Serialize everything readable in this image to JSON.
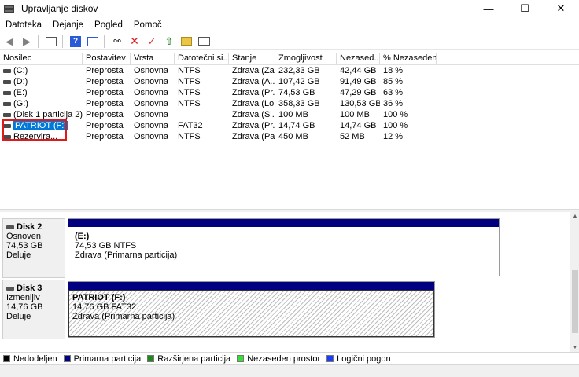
{
  "window": {
    "title": "Upravljanje diskov",
    "minimize": "—",
    "maximize": "☐",
    "close": "✕"
  },
  "menu": [
    "Datoteka",
    "Dejanje",
    "Pogled",
    "Pomoč"
  ],
  "toolbar_icons": [
    "back-arrow-icon",
    "forward-arrow-icon",
    "console-tree-icon",
    "help-icon",
    "properties-icon",
    "connect-icon",
    "delete-icon",
    "check-icon",
    "import-icon",
    "folder-icon",
    "rescan-icon"
  ],
  "columns": [
    "Nosilec",
    "Postavitev",
    "Vrsta",
    "Datotečni si...",
    "Stanje",
    "Zmogljivost",
    "Nezased...",
    "% Nezaseden..."
  ],
  "volumes": [
    {
      "name": "(C:)",
      "layout": "Preprosta",
      "type": "Osnovna",
      "fs": "NTFS",
      "status": "Zdrava (Za...",
      "capacity": "232,33 GB",
      "free": "42,44 GB",
      "pct": "18 %"
    },
    {
      "name": "(D:)",
      "layout": "Preprosta",
      "type": "Osnovna",
      "fs": "NTFS",
      "status": "Zdrava (A...",
      "capacity": "107,42 GB",
      "free": "91,49 GB",
      "pct": "85 %"
    },
    {
      "name": "(E:)",
      "layout": "Preprosta",
      "type": "Osnovna",
      "fs": "NTFS",
      "status": "Zdrava (Pr...",
      "capacity": "74,53 GB",
      "free": "47,29 GB",
      "pct": "63 %"
    },
    {
      "name": "(G:)",
      "layout": "Preprosta",
      "type": "Osnovna",
      "fs": "NTFS",
      "status": "Zdrava (Lo...",
      "capacity": "358,33 GB",
      "free": "130,53 GB",
      "pct": "36 %"
    },
    {
      "name": "(Disk 1 particija 2)",
      "layout": "Preprosta",
      "type": "Osnovna",
      "fs": "",
      "status": "Zdrava (Si...",
      "capacity": "100 MB",
      "free": "100 MB",
      "pct": "100 %"
    },
    {
      "name": "PATRIOT (F:)",
      "layout": "Preprosta",
      "type": "Osnovna",
      "fs": "FAT32",
      "status": "Zdrava (Pr...",
      "capacity": "14,74 GB",
      "free": "14,74 GB",
      "pct": "100 %"
    },
    {
      "name": "Rezervira...",
      "layout": "Preprosta",
      "type": "Osnovna",
      "fs": "NTFS",
      "status": "Zdrava (Pa...",
      "capacity": "450 MB",
      "free": "52 MB",
      "pct": "12 %"
    }
  ],
  "disks": [
    {
      "name": "Disk 2",
      "kind": "Osnoven",
      "size": "74,53 GB",
      "state": "Deluje",
      "partition": {
        "name": "(E:)",
        "size_fs": "74,53 GB NTFS",
        "status": "Zdrava (Primarna particija)"
      }
    },
    {
      "name": "Disk 3",
      "kind": "Izmenljiv",
      "size": "14,76 GB",
      "state": "Deluje",
      "partition": {
        "name": "PATRIOT  (F:)",
        "size_fs": "14,76 GB FAT32",
        "status": "Zdrava (Primarna particija)"
      }
    }
  ],
  "legend": [
    {
      "label": "Nedodeljen",
      "color": "#000000"
    },
    {
      "label": "Primarna particija",
      "color": "#000080"
    },
    {
      "label": "Razširjena particija",
      "color": "#1a8a1a"
    },
    {
      "label": "Nezaseden prostor",
      "color": "#33e033"
    },
    {
      "label": "Logični pogon",
      "color": "#1a3cff"
    }
  ]
}
